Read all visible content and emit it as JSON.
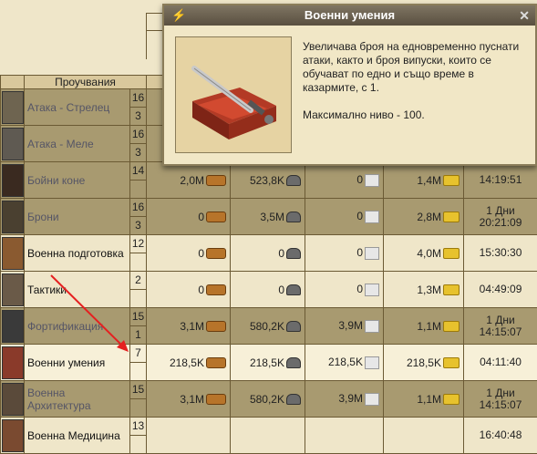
{
  "header": {
    "trainings_label": "Проучвания"
  },
  "tooltip": {
    "title": "Военни умения",
    "description": "Увеличава броя на едновременно пуснати атаки, както и броя випуски, които се обучават по едно и също време в казармите, с 1.",
    "max_level": "Максимално ниво - 100.",
    "icon": "lightning-icon"
  },
  "rows": [
    {
      "name": "Атака - Стрелец",
      "level_top": "16",
      "level_bottom": "3",
      "wood": "",
      "stone": "",
      "marble": "",
      "gold": "",
      "time": "",
      "style": "odd",
      "thumb": "#6e6450"
    },
    {
      "name": "Атака - Меле",
      "level_top": "16",
      "level_bottom": "3",
      "wood": "",
      "stone": "",
      "marble": "",
      "gold": "",
      "time": "",
      "style": "odd",
      "thumb": "#5f5a52"
    },
    {
      "name": "Бойни коне",
      "level_top": "14",
      "level_bottom": "",
      "wood": "2,0M",
      "stone": "523,8K",
      "marble": "0",
      "gold": "1,4M",
      "time": "14:19:51",
      "style": "odd",
      "thumb": "#3a2a20"
    },
    {
      "name": "Брони",
      "level_top": "16",
      "level_bottom": "3",
      "wood": "0",
      "stone": "3,5M",
      "marble": "0",
      "gold": "2,8M",
      "time": "1 Дни\n20:21:09",
      "style": "odd",
      "thumb": "#4a4030"
    },
    {
      "name": "Военна подготовка",
      "level_top": "12",
      "level_bottom": "",
      "wood": "0",
      "stone": "0",
      "marble": "0",
      "gold": "4,0M",
      "time": "15:30:30",
      "style": "even",
      "thumb": "#8a5a30"
    },
    {
      "name": "Тактики",
      "level_top": "2",
      "level_bottom": "",
      "wood": "0",
      "stone": "0",
      "marble": "0",
      "gold": "1,3M",
      "time": "04:49:09",
      "style": "even",
      "thumb": "#6a5a48"
    },
    {
      "name": "Фортификация",
      "level_top": "15",
      "level_bottom": "1",
      "wood": "3,1M",
      "stone": "580,2K",
      "marble": "3,9M",
      "gold": "1,1M",
      "time": "1 Дни\n14:15:07",
      "style": "odd",
      "thumb": "#3a3a3a"
    },
    {
      "name": "Военни умения",
      "level_top": "7",
      "level_bottom": "",
      "wood": "218,5K",
      "stone": "218,5K",
      "marble": "218,5K",
      "gold": "218,5K",
      "time": "04:11:40",
      "style": "hl",
      "thumb": "#8a3a2a"
    },
    {
      "name": "Военна Архитектура",
      "level_top": "15",
      "level_bottom": "",
      "wood": "3,1M",
      "stone": "580,2K",
      "marble": "3,9M",
      "gold": "1,1M",
      "time": "1 Дни\n14:15:07",
      "style": "odd",
      "thumb": "#5a4a3a"
    },
    {
      "name": "Военна Медицина",
      "level_top": "13",
      "level_bottom": "",
      "wood": "",
      "stone": "",
      "marble": "",
      "gold": "",
      "time": "16:40:48",
      "style": "even",
      "thumb": "#7a4a30"
    }
  ],
  "colors": {
    "arrow": "#e52020",
    "odd_row": "#a89a70",
    "even_row": "#efe6c9"
  }
}
